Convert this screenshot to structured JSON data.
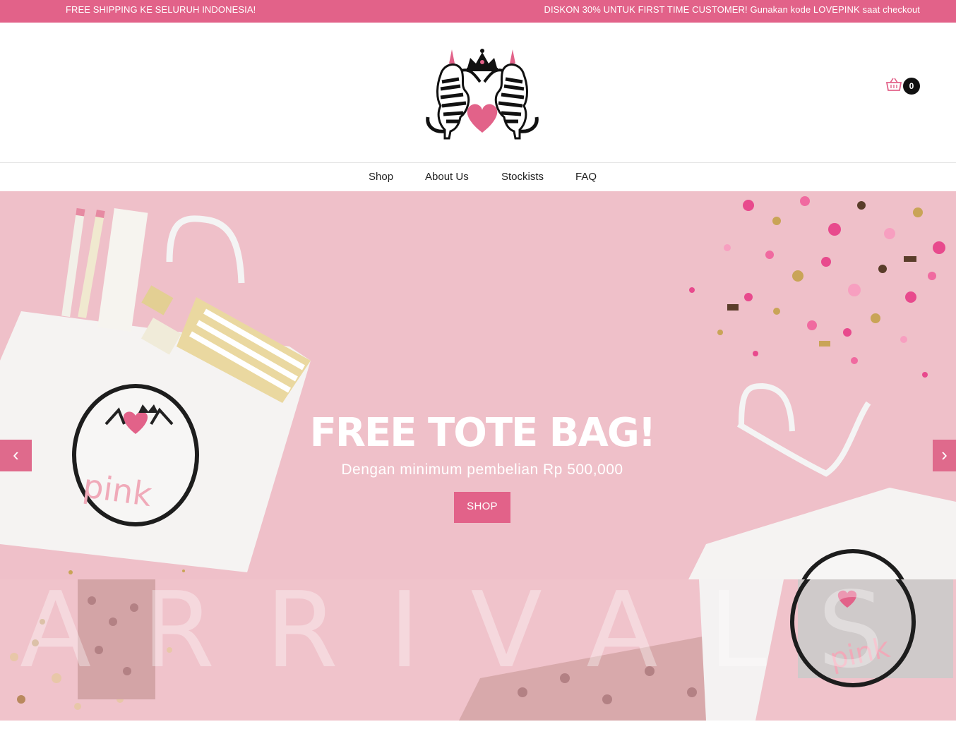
{
  "announcement": {
    "left_text": "FREE SHIPPING KE SELURUH INDONESIA!",
    "right_text": "DISKON 30% UNTUK FIRST TIME CUSTOMER! Gunakan kode LOVEPINK saat checkout"
  },
  "header": {
    "logo_icon": "zebra-crown-heart-logo",
    "cart": {
      "icon": "basket-icon",
      "count": "0"
    }
  },
  "nav": {
    "items": [
      {
        "label": "Shop"
      },
      {
        "label": "About Us"
      },
      {
        "label": "Stockists"
      },
      {
        "label": "FAQ"
      }
    ]
  },
  "hero": {
    "title": "FREE TOTE BAG!",
    "subtitle": "Dengan minimum pembelian Rp 500,000",
    "button_label": "SHOP",
    "tote_print": "pink",
    "prev_arrow": "‹",
    "next_arrow": "›"
  },
  "banner2": {
    "background_word": "ARRIVALS",
    "tote_print": "pink"
  },
  "colors": {
    "accent": "#e26289",
    "hero_bg": "#efc0c9",
    "dark": "#111111"
  }
}
